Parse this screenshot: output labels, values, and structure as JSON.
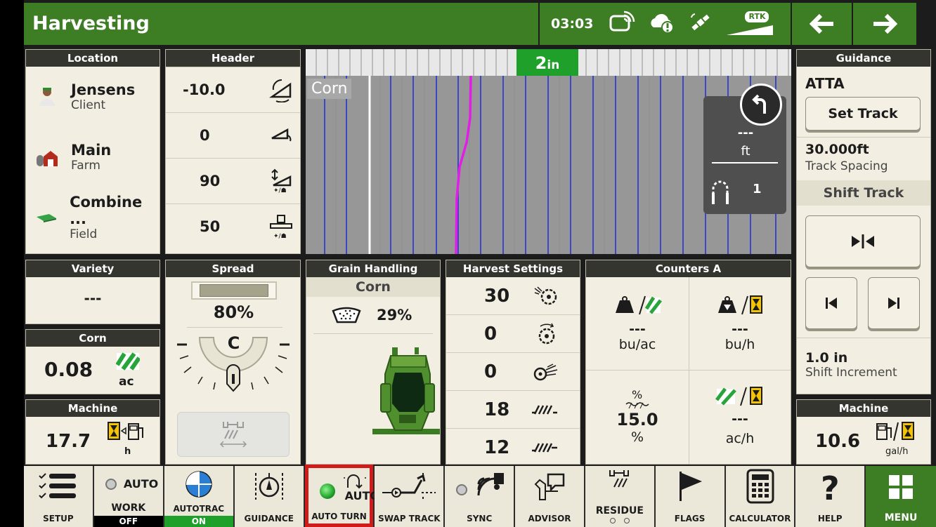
{
  "topbar": {
    "title": "Harvesting",
    "time": "03:03",
    "rtk_label": "RTK"
  },
  "location": {
    "header": "Location",
    "items": [
      {
        "name": "Jensens",
        "type": "Client"
      },
      {
        "name": "Main",
        "type": "Farm"
      },
      {
        "name": "Combine ...",
        "type": "Field"
      }
    ]
  },
  "header_panel": {
    "header": "Header",
    "values": [
      "-10.0",
      "0",
      "90",
      "50"
    ]
  },
  "map": {
    "offset_value": "2",
    "offset_unit": "in",
    "crop_label": "Corn",
    "turn_distance": "---",
    "turn_unit": "ft",
    "turn_count": "1"
  },
  "guidance": {
    "header": "Guidance",
    "track_name": "ATTA",
    "set_track": "Set Track",
    "spacing_value": "30.000ft",
    "spacing_label": "Track Spacing",
    "shift_track": "Shift Track",
    "increment_value": "1.0 in",
    "increment_label": "Shift Increment"
  },
  "variety": {
    "header": "Variety",
    "value": "---"
  },
  "corn_area": {
    "header": "Corn",
    "value": "0.08",
    "unit": "ac"
  },
  "machine_left": {
    "header": "Machine",
    "value": "17.7",
    "unit": "h"
  },
  "spread": {
    "header": "Spread",
    "percent": "80%",
    "position": "C",
    "fill_fraction": 0.8
  },
  "grain": {
    "header": "Grain Handling",
    "crop": "Corn",
    "tank_percent": "29%"
  },
  "harvest_settings": {
    "header": "Harvest Settings",
    "values": [
      "30",
      "0",
      "0",
      "18",
      "12"
    ]
  },
  "counters": {
    "header": "Counters A",
    "cells": [
      {
        "value": "---",
        "unit": "bu/ac"
      },
      {
        "value": "---",
        "unit": "bu/h"
      },
      {
        "value": "15.0",
        "unit": "%"
      },
      {
        "value": "---",
        "unit": "ac/h"
      }
    ]
  },
  "machine_right": {
    "header": "Machine",
    "value": "10.6",
    "unit": "gal/h"
  },
  "bottom_bar": {
    "setup": "SETUP",
    "work_auto": "AUTO",
    "work": "WORK",
    "work_state": "OFF",
    "autotrac": "AUTOTRAC",
    "autotrac_state": "ON",
    "guidance": "GUIDANCE",
    "auto_turn": "AUTO TURN",
    "auto_turn_icon_text": "AUTO",
    "swap_track": "SWAP TRACK",
    "sync": "SYNC",
    "advisor": "ADVISOR",
    "residue": "RESIDUE",
    "flags": "FLAGS",
    "calculator": "CALCULATOR",
    "help": "HELP",
    "menu": "MENU"
  },
  "colors": {
    "jd_green": "#3d7d24",
    "active_green": "#1fa02a",
    "highlight_red": "#d11a1a",
    "path_magenta": "#e21de8",
    "guide_blue": "#1d2fcf"
  }
}
